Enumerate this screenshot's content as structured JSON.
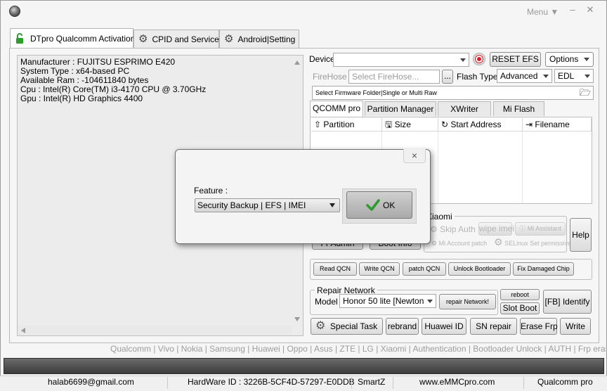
{
  "window": {
    "menu_label": "Menu ▼"
  },
  "tabs": [
    {
      "label": "DTpro Qualcomm Activation"
    },
    {
      "label": "CPID and Services"
    },
    {
      "label": "Android|Setting"
    }
  ],
  "system_info": [
    "Manufacturer : FUJITSU ESPRIMO E420",
    "System Type : x64-based PC",
    "Available Ram : -104611840 bytes",
    "Cpu : Intel(R) Core(TM) i3-4170 CPU @ 3.70GHz",
    "Gpu : Intel(R) HD Graphics 4400"
  ],
  "device": {
    "label": "Device",
    "value": ""
  },
  "reset_efs": "RESET EFS",
  "options": "Options",
  "firehose": {
    "label": "FireHose",
    "placeholder": "Select FireHose...",
    "browse": "..."
  },
  "flash_type": {
    "label": "Flash Type",
    "value": "Advanced"
  },
  "edl": {
    "value": "EDL"
  },
  "firmware_folder": "Select Firmware Folder|Single or Multi Raw",
  "subtabs": [
    "QCOMM pro",
    "Partition Manager",
    "XWriter",
    "Mi Flash"
  ],
  "grid_headers": [
    "Partition",
    "Size",
    "Start Address",
    "Filename"
  ],
  "xiaomi": {
    "title": "Xiaomi",
    "skip_auth": "Skip Auth",
    "wipe_imei": "wipe imei",
    "mi_assistant": "Mi Assistant",
    "mi_account_patch": "Mi Account patch",
    "selinux": "SELinux Set permissive"
  },
  "left_buttons": {
    "fr_admin": "Fr Admin",
    "boot_info": "Boot Info"
  },
  "help": "Help",
  "actions_row": [
    "Read QCN",
    "Write QCN",
    "patch QCN",
    "Unlock Bootloader",
    "Fix Damaged Chip"
  ],
  "repair_network": {
    "title": "Repair Network",
    "model_label": "Model",
    "model_value": "Honor 50 lite [Newton",
    "repair_btn": "repair Network!",
    "reboot": "reboot",
    "slot_boot": "Slot Boot",
    "fb_identify": "[FB] Identify"
  },
  "bottom_buttons": [
    "Special Task",
    "rebrand",
    "Huawei ID",
    "SN repair",
    "Erase Frp",
    "Write"
  ],
  "brand_line": "Qualcomm | Vivo | Nokia | Samsung | Huawei | Oppo | Asus | ZTE | LG | Xiaomi | Authentication | Bootloader Unlock | AUTH | Frp erase | PM",
  "footer": {
    "email": "halab6699@gmail.com",
    "hardware_id": "HardWare ID : 3226B-5CF4D-57297-E0DDB",
    "user": "SmartZ",
    "site": "www.eMMCpro.com",
    "product": "Qualcomm pro"
  },
  "dialog": {
    "feature_label": "Feature :",
    "feature_value": "Security Backup | EFS | IMEI",
    "ok": "OK",
    "close": "×"
  }
}
